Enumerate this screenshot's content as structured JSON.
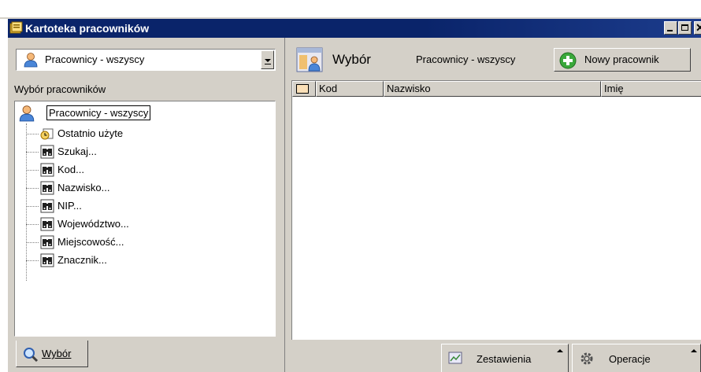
{
  "window": {
    "title": "Kartoteka pracowników",
    "controls": [
      "minimize",
      "maximize",
      "close"
    ]
  },
  "left_panel": {
    "combo_value": "Pracownicy - wszyscy",
    "section_label": "Wybór pracowników",
    "tree": {
      "root_label": "Pracownicy - wszyscy",
      "items": [
        {
          "label": "Ostatnio użyte",
          "icon": "recent-icon"
        },
        {
          "label": "Szukaj...",
          "icon": "binoculars-icon"
        },
        {
          "label": "Kod...",
          "icon": "binoculars-icon"
        },
        {
          "label": "Nazwisko...",
          "icon": "binoculars-icon"
        },
        {
          "label": "NIP...",
          "icon": "binoculars-icon"
        },
        {
          "label": "Województwo...",
          "icon": "binoculars-icon"
        },
        {
          "label": "Miejscowość...",
          "icon": "binoculars-icon"
        },
        {
          "label": "Znacznik...",
          "icon": "binoculars-icon"
        }
      ]
    },
    "tab_label": "Wybór"
  },
  "right_panel": {
    "title_main": "Wybór",
    "title_sub": "Pracownicy - wszyscy",
    "new_button_label": "Nowy pracownik",
    "columns": [
      "Kod",
      "Nazwisko",
      "Imię"
    ],
    "rows": [],
    "bottom_buttons": [
      "Zestawienia",
      "Operacje"
    ]
  }
}
